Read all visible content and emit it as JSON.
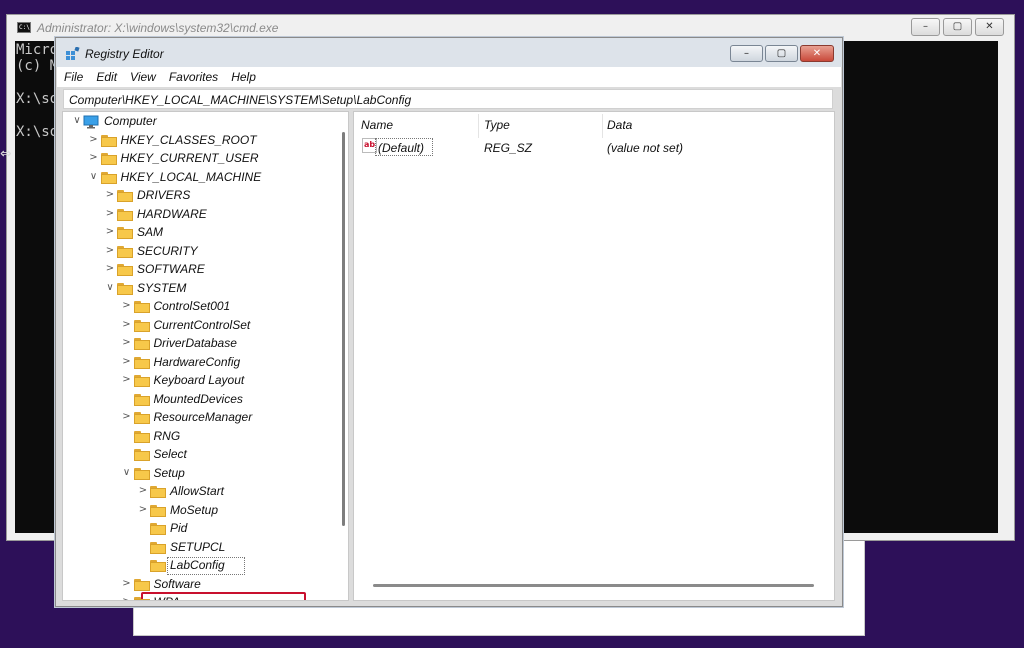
{
  "cmd": {
    "title": "Administrator: X:\\windows\\system32\\cmd.exe",
    "icon_text": "C:\\",
    "lines": [
      "Micro",
      "(c) M",
      "",
      "X:\\so",
      "",
      "X:\\so"
    ],
    "buttons": {
      "minimize": "–",
      "maximize": "▢",
      "close": "✕"
    }
  },
  "regedit": {
    "title": "Registry Editor",
    "menu": [
      "File",
      "Edit",
      "View",
      "Favorites",
      "Help"
    ],
    "address": "Computer\\HKEY_LOCAL_MACHINE\\SYSTEM\\Setup\\LabConfig",
    "buttons": {
      "minimize": "–",
      "maximize": "▢",
      "close": "✕"
    },
    "tree": [
      {
        "label": "Computer",
        "expander": "∨",
        "kind": "computer"
      },
      {
        "label": "HKEY_CLASSES_ROOT",
        "expander": ">",
        "kind": "folder"
      },
      {
        "label": "HKEY_CURRENT_USER",
        "expander": ">",
        "kind": "folder"
      },
      {
        "label": "HKEY_LOCAL_MACHINE",
        "expander": "∨",
        "kind": "folder"
      },
      {
        "label": "DRIVERS",
        "expander": ">",
        "kind": "folder"
      },
      {
        "label": "HARDWARE",
        "expander": ">",
        "kind": "folder"
      },
      {
        "label": "SAM",
        "expander": ">",
        "kind": "folder"
      },
      {
        "label": "SECURITY",
        "expander": ">",
        "kind": "folder"
      },
      {
        "label": "SOFTWARE",
        "expander": ">",
        "kind": "folder"
      },
      {
        "label": "SYSTEM",
        "expander": "∨",
        "kind": "folder"
      },
      {
        "label": "ControlSet001",
        "expander": ">",
        "kind": "folder"
      },
      {
        "label": "CurrentControlSet",
        "expander": ">",
        "kind": "folder"
      },
      {
        "label": "DriverDatabase",
        "expander": ">",
        "kind": "folder"
      },
      {
        "label": "HardwareConfig",
        "expander": ">",
        "kind": "folder"
      },
      {
        "label": "Keyboard Layout",
        "expander": ">",
        "kind": "folder"
      },
      {
        "label": "MountedDevices",
        "expander": "",
        "kind": "folder"
      },
      {
        "label": "ResourceManager",
        "expander": ">",
        "kind": "folder"
      },
      {
        "label": "RNG",
        "expander": "",
        "kind": "folder"
      },
      {
        "label": "Select",
        "expander": "",
        "kind": "folder"
      },
      {
        "label": "Setup",
        "expander": "∨",
        "kind": "folder"
      },
      {
        "label": "AllowStart",
        "expander": ">",
        "kind": "folder"
      },
      {
        "label": "MoSetup",
        "expander": ">",
        "kind": "folder"
      },
      {
        "label": "Pid",
        "expander": "",
        "kind": "folder"
      },
      {
        "label": "SETUPCL",
        "expander": "",
        "kind": "folder"
      },
      {
        "label": "LabConfig",
        "expander": "",
        "kind": "folder",
        "selected": true
      },
      {
        "label": "Software",
        "expander": ">",
        "kind": "folder"
      },
      {
        "label": "WPA",
        "expander": ">",
        "kind": "folder"
      }
    ],
    "columns": {
      "name": "Name",
      "type": "Type",
      "data": "Data"
    },
    "values": [
      {
        "name": "(Default)",
        "type": "REG_SZ",
        "data": "(value not set)",
        "icon": "ab"
      }
    ]
  }
}
